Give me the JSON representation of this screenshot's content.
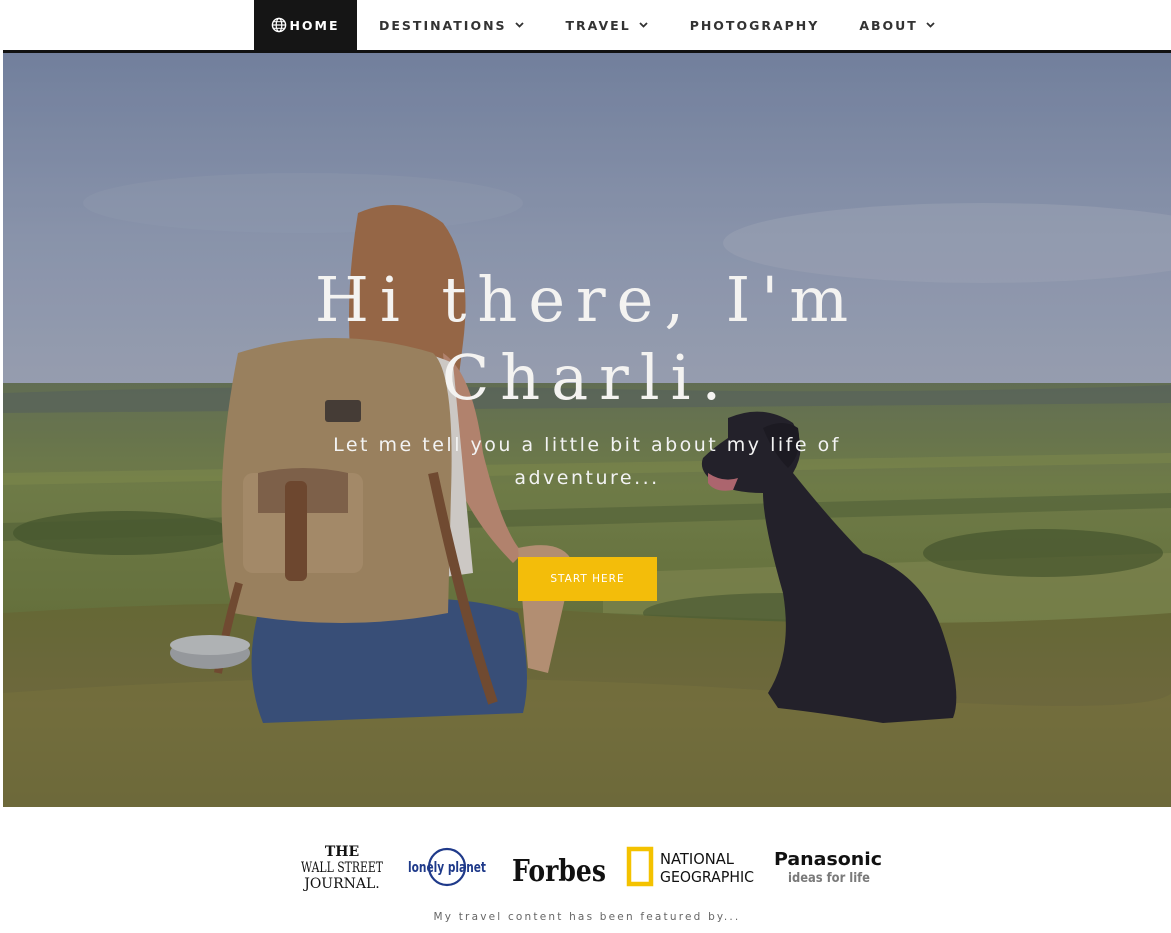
{
  "nav": {
    "items": [
      {
        "label": "HOME",
        "active": true,
        "icon": "globe-icon"
      },
      {
        "label": "DESTINATIONS",
        "dropdown": true
      },
      {
        "label": "TRAVEL",
        "dropdown": true
      },
      {
        "label": "PHOTOGRAPHY",
        "dropdown": false
      },
      {
        "label": "ABOUT",
        "dropdown": true
      }
    ]
  },
  "hero": {
    "title_line1": "Hi there, I'm",
    "title_line2": "Charli.",
    "subtitle": "Let me tell you a little bit about my life of adventure...",
    "cta_label": "START HERE",
    "cta_color": "#f3bd0a"
  },
  "press": {
    "logos": [
      {
        "name": "wall-street-journal-logo",
        "text": "THE WALL STREET JOURNAL."
      },
      {
        "name": "lonely-planet-logo",
        "text": "lonely planet"
      },
      {
        "name": "forbes-logo",
        "text": "Forbes"
      },
      {
        "name": "national-geographic-logo",
        "text": "NATIONAL GEOGRAPHIC"
      },
      {
        "name": "panasonic-logo",
        "text": "Panasonic ideas for life"
      }
    ],
    "caption": "My travel content has been featured by..."
  }
}
